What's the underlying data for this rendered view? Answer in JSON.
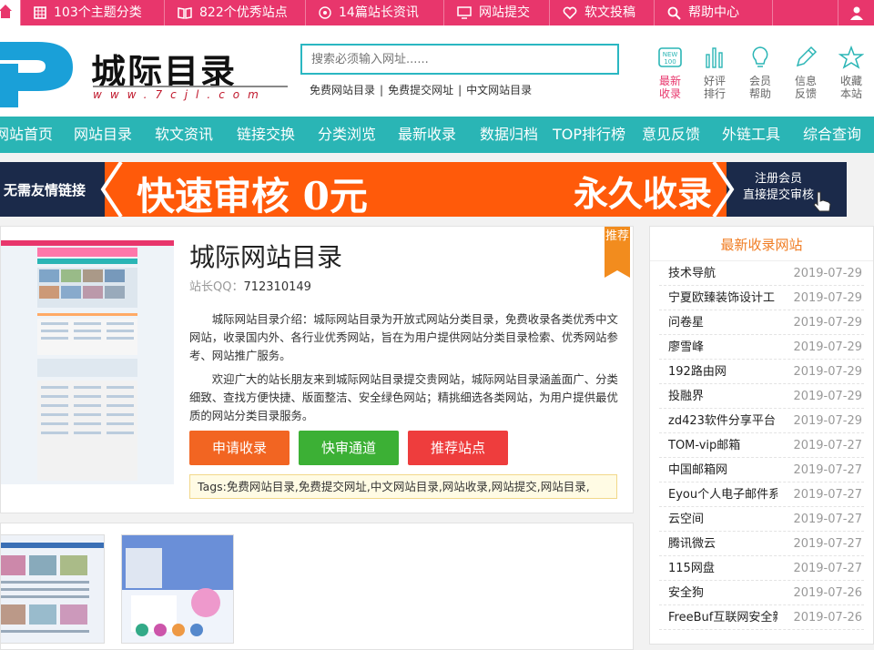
{
  "topbar": {
    "items": [
      {
        "label": "103个主题分类",
        "icon": "grid-icon"
      },
      {
        "label": "822个优秀站点",
        "icon": "book-icon"
      },
      {
        "label": "14篇站长资讯",
        "icon": "target-icon"
      },
      {
        "label": "网站提交",
        "icon": "monitor-icon"
      },
      {
        "label": "软文投稿",
        "icon": "heart-icon"
      },
      {
        "label": "帮助中心",
        "icon": "search-icon"
      }
    ]
  },
  "header": {
    "logo_text": "城际目录",
    "logo_url": "www.7cjl.com",
    "search_placeholder": "搜索必须输入网址......",
    "quick_links": [
      "免费网站目录",
      "免费提交网址",
      "中文网站目录"
    ],
    "quick_sep": "|",
    "icons": [
      {
        "line1": "最新",
        "line2": "收录",
        "icon": "new-badge-icon"
      },
      {
        "line1": "好评",
        "line2": "排行",
        "icon": "bar-chart-icon"
      },
      {
        "line1": "会员",
        "line2": "帮助",
        "icon": "lightbulb-icon"
      },
      {
        "line1": "信息",
        "line2": "反馈",
        "icon": "pencil-icon"
      },
      {
        "line1": "收藏",
        "line2": "本站",
        "icon": "star-icon"
      }
    ]
  },
  "nav": [
    "网站首页",
    "网站目录",
    "软文资讯",
    "链接交换",
    "分类浏览",
    "最新收录",
    "数据归档",
    "TOP排行榜",
    "意见反馈",
    "外链工具",
    "综合查询"
  ],
  "banner": {
    "left_text": "无需友情链接",
    "big_left": "快速审核 0元",
    "big_right": "永久收录",
    "right_line1": "注册会员",
    "right_line2": "直接提交审核"
  },
  "site": {
    "title": "城际网站目录",
    "qq_label": "站长QQ：",
    "qq": "712310149",
    "tag": "推荐",
    "intro1": "城际网站目录介绍：城际网站目录为开放式网站分类目录，免费收录各类优秀中文网站，收录国内外、各行业优秀网站，旨在为用户提供网站分类目录检索、优秀网站参考、网站推广服务。",
    "intro2": "欢迎广大的站长朋友来到城际网站目录提交贵网站，城际网站目录涵盖面广、分类细致、查找方便快捷、版面整洁、安全绿色网站；精挑细选各类网站，为用户提供最优质的网站分类目录服务。",
    "buttons": [
      {
        "label": "申请收录",
        "color": "#f26522"
      },
      {
        "label": "快审通道",
        "color": "#3cb035"
      },
      {
        "label": "推荐站点",
        "color": "#ee3d3d"
      }
    ],
    "tags": "Tags:免费网站目录,免费提交网址,中文网站目录,网站收录,网站提交,网站目录,"
  },
  "sidebar": {
    "title": "最新收录网站",
    "items": [
      {
        "name": "技术导航",
        "date": "2019-07-29"
      },
      {
        "name": "宁夏欧臻装饰设计工",
        "date": "2019-07-29"
      },
      {
        "name": "问卷星",
        "date": "2019-07-29"
      },
      {
        "name": "廖雪峰",
        "date": "2019-07-29"
      },
      {
        "name": "192路由网",
        "date": "2019-07-29"
      },
      {
        "name": "投融界",
        "date": "2019-07-29"
      },
      {
        "name": "zd423软件分享平台",
        "date": "2019-07-29"
      },
      {
        "name": "TOM-vip邮箱",
        "date": "2019-07-27"
      },
      {
        "name": "中国邮箱网",
        "date": "2019-07-27"
      },
      {
        "name": "Eyou个人电子邮件系",
        "date": "2019-07-27"
      },
      {
        "name": "云空间",
        "date": "2019-07-27"
      },
      {
        "name": "腾讯微云",
        "date": "2019-07-27"
      },
      {
        "name": "115网盘",
        "date": "2019-07-27"
      },
      {
        "name": "安全狗",
        "date": "2019-07-26"
      },
      {
        "name": "FreeBuf互联网安全新",
        "date": "2019-07-26"
      }
    ]
  },
  "colors": {
    "topbar": "#e8366c",
    "nav": "#2ab5b5",
    "accent": "#f07c22"
  }
}
